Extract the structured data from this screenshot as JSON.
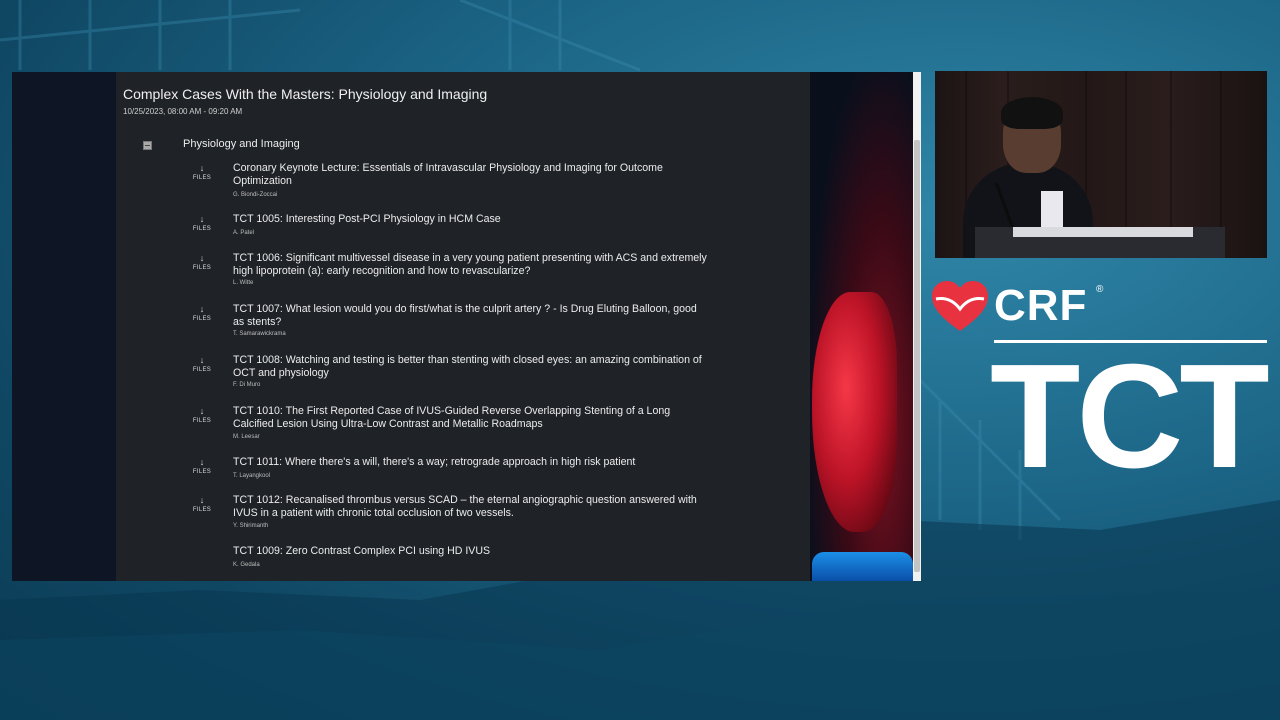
{
  "session": {
    "title": "Complex Cases With the Masters: Physiology and Imaging",
    "datetime": "10/25/2023, 08:00 AM - 09:20 AM",
    "section_title": "Physiology and Imaging",
    "files_label": "FILES",
    "items": [
      {
        "title": "Coronary Keynote Lecture: Essentials of Intravascular Physiology and Imaging for Outcome Optimization",
        "author": "G. Biondi-Zoccai",
        "has_files": true
      },
      {
        "title": "TCT 1005: Interesting Post-PCI Physiology in HCM Case",
        "author": "A. Patel",
        "has_files": true
      },
      {
        "title": "TCT 1006: Significant multivessel disease in a very young patient presenting with ACS and extremely high lipoprotein (a): early recognition and how to revascularize?",
        "author": "L. Witte",
        "has_files": true
      },
      {
        "title": "TCT 1007: What lesion would you do first/what is the culprit artery ? - Is Drug Eluting Balloon, good as stents?",
        "author": "T. Samarawickrama",
        "has_files": true
      },
      {
        "title": "TCT 1008: Watching and testing is better than stenting with closed eyes: an amazing combination of OCT and physiology",
        "author": "F. Di Muro",
        "has_files": true
      },
      {
        "title": "TCT 1010: The First Reported Case of IVUS-Guided Reverse Overlapping Stenting of a Long Calcified Lesion Using Ultra-Low Contrast and Metallic Roadmaps",
        "author": "M. Leesar",
        "has_files": true
      },
      {
        "title": "TCT 1011: Where there's a will, there's a way; retrograde approach in high risk patient",
        "author": "T. Layangkool",
        "has_files": true
      },
      {
        "title": "TCT 1012: Recanalised thrombus versus SCAD – the eternal angiographic question answered with IVUS in a patient with chronic total occlusion of two vessels.",
        "author": "Y. Shirimanth",
        "has_files": true
      },
      {
        "title": "TCT 1009: Zero Contrast Complex PCI using HD IVUS",
        "author": "K. Gedala",
        "has_files": false
      }
    ]
  },
  "branding": {
    "crf": "CRF",
    "registered": "®",
    "tct": "TCT",
    "heart_color": "#e8323f"
  },
  "icons": {
    "files": "download-arrow-icon",
    "section_toggle": "collapse-square-icon"
  }
}
